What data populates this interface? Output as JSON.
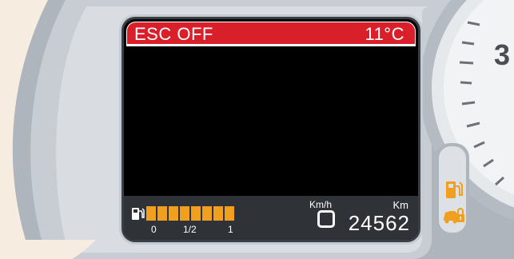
{
  "display": {
    "warning_text": "ESC OFF",
    "temperature": "11°C",
    "fuel": {
      "level_fraction": 1.0,
      "segments": 8,
      "tick_labels": [
        "0",
        "1/2",
        "1"
      ]
    },
    "speed_unit": "Km/h",
    "speed_value": "0",
    "odometer_unit": "Km",
    "odometer_value": "24562"
  },
  "right_gauge": {
    "partial_number": "3"
  },
  "warning_lights": [
    {
      "icon": "fuel-pump-icon"
    },
    {
      "icon": "car-lock-icon"
    }
  ],
  "colors": {
    "warning_bar": "#d81f2a",
    "fuel_segments": "#f0a01e",
    "indicator_amber": "#f0a01e"
  }
}
